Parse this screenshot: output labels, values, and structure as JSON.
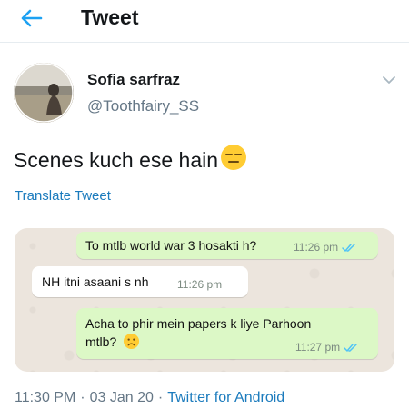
{
  "header": {
    "title": "Tweet",
    "back_icon": "back-arrow-icon",
    "accent_color": "#1da1f2"
  },
  "tweet": {
    "author_name": "Sofia sarfraz",
    "author_handle": "@Toothfairy_SS",
    "text": "Scenes kuch ese hain",
    "text_emoji": "expressionless-face-emoji",
    "translate_label": "Translate Tweet",
    "time": "11:30 PM",
    "date": "03 Jan 20",
    "separator": "·",
    "source": "Twitter for Android",
    "link_color": "#1b7bbd"
  },
  "chat": {
    "messages": [
      {
        "direction": "outgoing",
        "text": "To mtlb world war 3 hosakti h?",
        "time": "11:26 pm",
        "status_icon": "double-check-icon"
      },
      {
        "direction": "incoming",
        "text": "NH itni asaani s nh",
        "time": "11:26 pm"
      },
      {
        "direction": "outgoing",
        "text": "Acha to phir mein papers k liye Parhoon mtlb?",
        "emoji": "frowning-face-emoji",
        "time": "11:27 pm",
        "status_icon": "double-check-icon"
      }
    ],
    "outgoing_color": "#dcf8c6",
    "incoming_color": "#ffffff"
  }
}
